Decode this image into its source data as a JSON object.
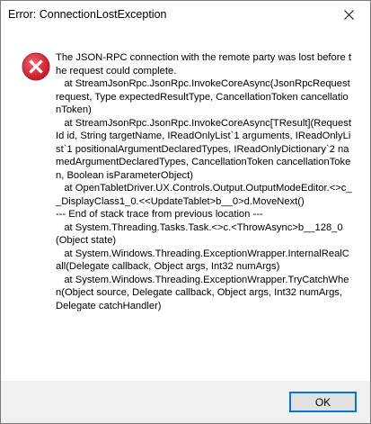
{
  "window": {
    "title": "Error: ConnectionLostException"
  },
  "titlebar": {
    "close_icon": "close-icon"
  },
  "dialog": {
    "icon": "error-icon",
    "message": "The JSON-RPC connection with the remote party was lost before the request could complete.\n   at StreamJsonRpc.JsonRpc.InvokeCoreAsync(JsonRpcRequest request, Type expectedResultType, CancellationToken cancellationToken)\n   at StreamJsonRpc.JsonRpc.InvokeCoreAsync[TResult](RequestId id, String targetName, IReadOnlyList`1 arguments, IReadOnlyList`1 positionalArgumentDeclaredTypes, IReadOnlyDictionary`2 namedArgumentDeclaredTypes, CancellationToken cancellationToken, Boolean isParameterObject)\n   at OpenTabletDriver.UX.Controls.Output.OutputModeEditor.<>c__DisplayClass1_0.<<UpdateTablet>b__0>d.MoveNext()\n--- End of stack trace from previous location ---\n   at System.Threading.Tasks.Task.<>c.<ThrowAsync>b__128_0(Object state)\n   at System.Windows.Threading.ExceptionWrapper.InternalRealCall(Delegate callback, Object args, Int32 numArgs)\n   at System.Windows.Threading.ExceptionWrapper.TryCatchWhen(Object source, Delegate callback, Object args, Int32 numArgs, Delegate catchHandler)",
    "ok_label": "OK"
  },
  "colors": {
    "error_red": "#e81123",
    "focus_blue": "#0078d7",
    "footer_bg": "#f0f0f0"
  }
}
